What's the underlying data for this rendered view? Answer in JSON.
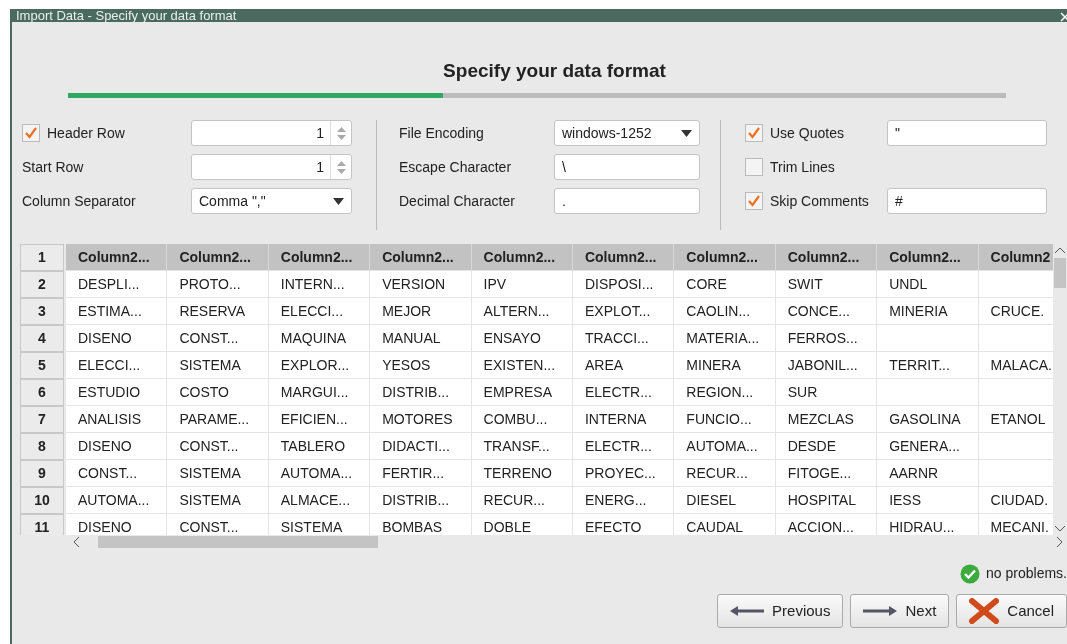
{
  "window": {
    "title": "Import Data - Specify your data format"
  },
  "heading": "Specify your data format",
  "progress": {
    "level": 0.4
  },
  "option_groups": [
    {
      "items": [
        {
          "kind": "checkbox",
          "label": "Header Row",
          "checked": true,
          "control": {
            "kind": "spinner",
            "value": "1"
          }
        },
        {
          "kind": "plain",
          "label": "Start Row",
          "control": {
            "kind": "spinner",
            "value": "1"
          }
        },
        {
          "kind": "plain",
          "label": "Column Separator",
          "control": {
            "kind": "select",
            "value": "Comma \",\""
          }
        }
      ]
    },
    {
      "items": [
        {
          "kind": "plain",
          "label": "File Encoding",
          "control": {
            "kind": "select",
            "value": "windows-1252"
          }
        },
        {
          "kind": "plain",
          "label": "Escape Character",
          "control": {
            "kind": "text",
            "value": "\\"
          }
        },
        {
          "kind": "plain",
          "label": "Decimal Character",
          "control": {
            "kind": "text",
            "value": "."
          }
        }
      ]
    },
    {
      "items": [
        {
          "kind": "checkbox",
          "label": "Use Quotes",
          "checked": true,
          "control": {
            "kind": "text",
            "value": "\""
          }
        },
        {
          "kind": "checkbox",
          "label": "Trim Lines",
          "checked": false
        },
        {
          "kind": "checkbox",
          "label": "Skip Comments",
          "checked": true,
          "control": {
            "kind": "text",
            "value": "#"
          }
        }
      ]
    }
  ],
  "table": {
    "header": {
      "number": "1",
      "cells": [
        "Column2...",
        "Column2...",
        "Column2...",
        "Column2...",
        "Column2...",
        "Column2...",
        "Column2...",
        "Column2...",
        "Column2...",
        "Column2"
      ]
    },
    "rows": [
      {
        "number": "2",
        "cells": [
          "DESPLI...",
          "PROTO...",
          "INTERN...",
          "VERSION",
          "IPV",
          "DISPOSI...",
          "CORE",
          "SWIT",
          "UNDL",
          null
        ]
      },
      {
        "number": "3",
        "cells": [
          "ESTIMA...",
          "RESERVA",
          "ELECCI...",
          "MEJOR",
          "ALTERN...",
          "EXPLOT...",
          "CAOLIN...",
          "CONCE...",
          "MINERIA",
          "CRUCE."
        ]
      },
      {
        "number": "4",
        "cells": [
          "DISENO",
          "CONST...",
          "MAQUINA",
          "MANUAL",
          "ENSAYO",
          "TRACCI...",
          "MATERIA...",
          "FERROS...",
          null,
          null
        ]
      },
      {
        "number": "5",
        "cells": [
          "ELECCI...",
          "SISTEMA",
          "EXPLOR...",
          "YESOS",
          "EXISTEN...",
          "AREA",
          "MINERA",
          "JABONIL...",
          "TERRIT...",
          "MALACA."
        ]
      },
      {
        "number": "6",
        "cells": [
          "ESTUDIO",
          "COSTO",
          "MARGUI...",
          "DISTRIB...",
          "EMPRESA",
          "ELECTR...",
          "REGION...",
          "SUR",
          null,
          null
        ]
      },
      {
        "number": "7",
        "cells": [
          "ANALISIS",
          "PARAME...",
          "EFICIEN...",
          "MOTORES",
          "COMBU...",
          "INTERNA",
          "FUNCIO...",
          "MEZCLAS",
          "GASOLINA",
          "ETANOL"
        ]
      },
      {
        "number": "8",
        "cells": [
          "DISENO",
          "CONST...",
          "TABLERO",
          "DIDACTI...",
          "TRANSF...",
          "ELECTR...",
          "AUTOMA...",
          "DESDE",
          "GENERA...",
          null
        ]
      },
      {
        "number": "9",
        "cells": [
          "CONST...",
          "SISTEMA",
          "AUTOMA...",
          "FERTIR...",
          "TERRENO",
          "PROYEC...",
          "RECUR...",
          "FITOGE...",
          "AARNR",
          null
        ]
      },
      {
        "number": "10",
        "cells": [
          "AUTOMA...",
          "SISTEMA",
          "ALMACE...",
          "DISTRIB...",
          "RECUR...",
          "ENERG...",
          "DIESEL",
          "HOSPITAL",
          "IESS",
          "CIUDAD."
        ]
      },
      {
        "number": "11",
        "cells": [
          "DISENO",
          "CONST...",
          "SISTEMA",
          "BOMBAS",
          "DOBLE",
          "EFECTO",
          "CAUDAL",
          "ACCION...",
          "HIDRAU...",
          "MECANI."
        ]
      }
    ]
  },
  "status": {
    "kind": "success",
    "text": "no problems."
  },
  "buttons": [
    {
      "kind": "previous",
      "label": "Previous"
    },
    {
      "kind": "next",
      "label": "Next"
    },
    {
      "kind": "cancel",
      "label": "Cancel"
    }
  ]
}
